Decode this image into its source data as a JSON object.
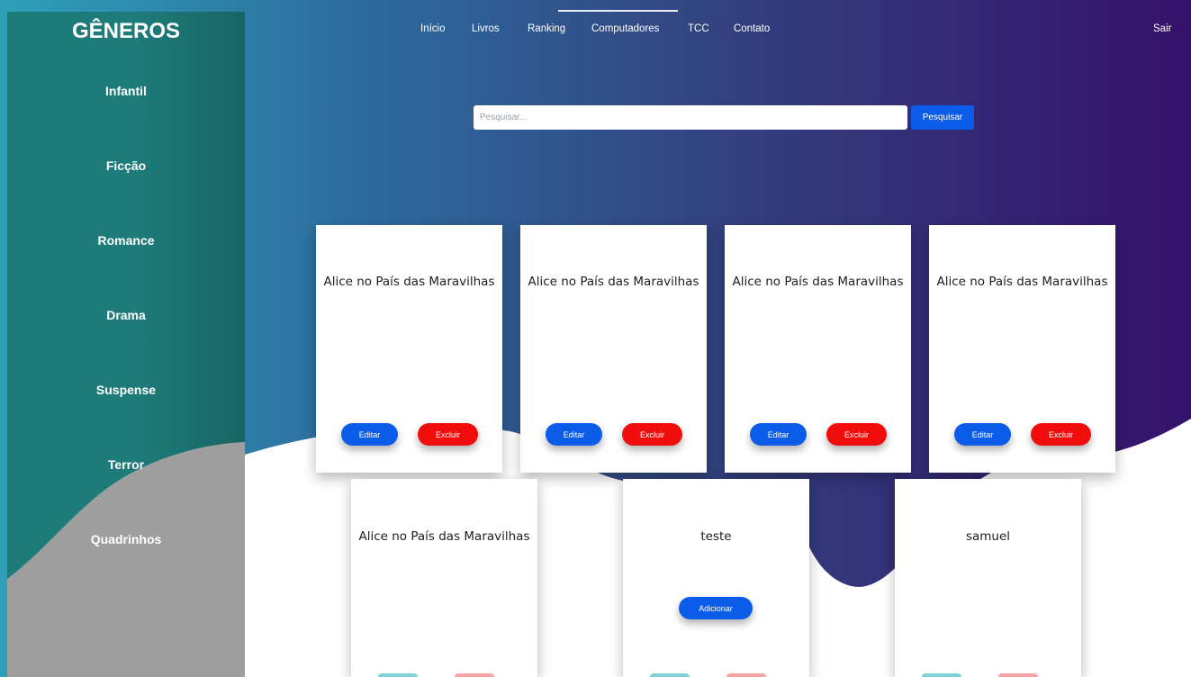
{
  "sidebar": {
    "title": "GÊNEROS",
    "genres": [
      "Infantil",
      "Ficção",
      "Romance",
      "Drama",
      "Suspense",
      "Terror",
      "Quadrinhos"
    ]
  },
  "nav": {
    "links": [
      "Início",
      "Livros",
      "Ranking",
      "Computadores",
      "TCC",
      "Contato"
    ],
    "logout": "Sair"
  },
  "search": {
    "placeholder": "Pesquisar...",
    "button": "Pesquisar"
  },
  "cards": [
    {
      "title": "Alice no País das Maravilhas",
      "edit": "Editar",
      "delete": "Excluir"
    },
    {
      "title": "Alice no País das Maravilhas",
      "edit": "Editar",
      "delete": "Excluir"
    },
    {
      "title": "Alice no País das Maravilhas",
      "edit": "Editar",
      "delete": "Excluir"
    },
    {
      "title": "Alice no País das Maravilhas",
      "edit": "Editar",
      "delete": "Excluir"
    },
    {
      "title": "Alice no País das Maravilhas"
    },
    {
      "title": "teste",
      "add": "Adicionar"
    },
    {
      "title": "samuel"
    }
  ],
  "colors": {
    "gradient_start": "#2ea0b8",
    "gradient_end": "#35116b",
    "sidebar": "#1d7b79",
    "sidebar_gray": "#9e9e9e",
    "primary_button": "#0b5ce8",
    "danger_button": "#f20d0d"
  }
}
